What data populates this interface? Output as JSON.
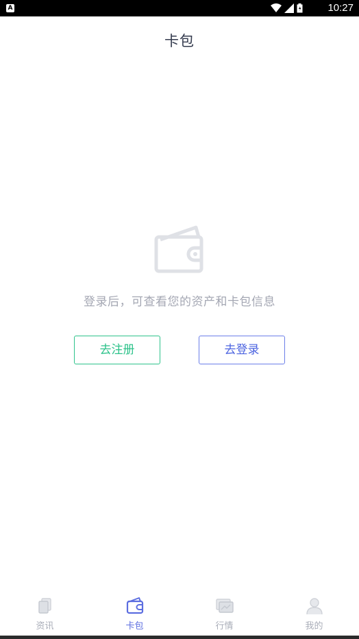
{
  "status_bar": {
    "notification_badge": "A",
    "time": "10:27",
    "icons": [
      "wifi-icon",
      "signal-icon",
      "battery-icon"
    ]
  },
  "header": {
    "title": "卡包"
  },
  "empty_state": {
    "icon": "wallet-icon",
    "message": "登录后，可查看您的资产和卡包信息",
    "register_label": "去注册",
    "login_label": "去登录"
  },
  "tabs": [
    {
      "label": "资讯",
      "icon": "news-icon",
      "active": false
    },
    {
      "label": "卡包",
      "icon": "wallet-icon",
      "active": true
    },
    {
      "label": "行情",
      "icon": "market-icon",
      "active": false
    },
    {
      "label": "我的",
      "icon": "profile-icon",
      "active": false
    }
  ],
  "colors": {
    "accent": "#5b6de0",
    "register": "#2cc28a",
    "text_muted": "#a4a7b3",
    "title": "#333a4d"
  }
}
